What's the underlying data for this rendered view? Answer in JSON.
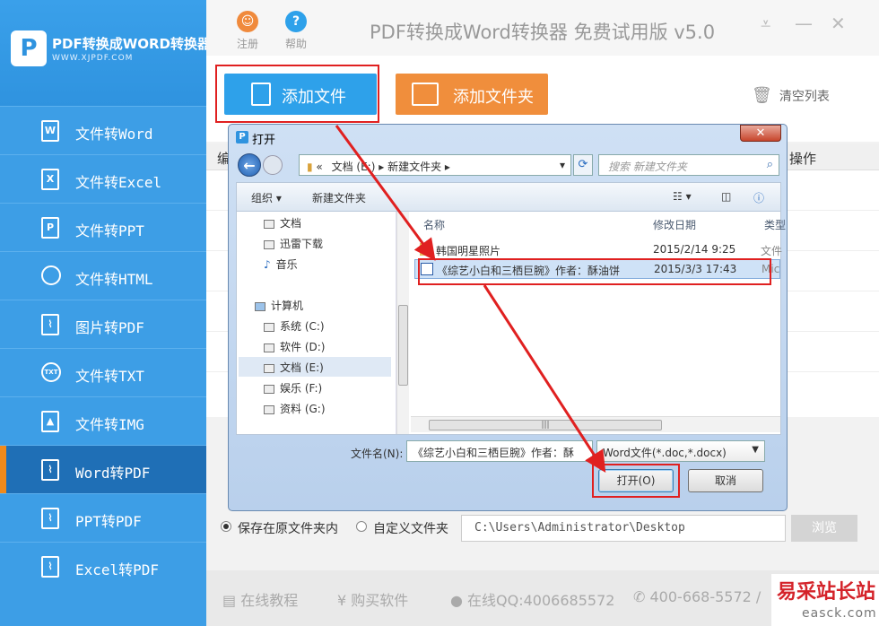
{
  "brand": {
    "title": "PDF转换成WORD转换器",
    "url": "WWW.XJPDF.COM",
    "logo_letter": "P"
  },
  "app_title": "PDF转换成Word转换器 免费试用版 v5.0",
  "top_buttons": [
    {
      "icon": "user-icon",
      "label": "注册"
    },
    {
      "icon": "help-icon",
      "label": "帮助"
    }
  ],
  "sidebar": {
    "items": [
      {
        "icon": "W",
        "label": "文件转Word"
      },
      {
        "icon": "X",
        "label": "文件转Excel"
      },
      {
        "icon": "P",
        "label": "文件转PPT"
      },
      {
        "icon": "globe-icon",
        "label": "文件转HTML"
      },
      {
        "icon": "pdf-icon",
        "label": "图片转PDF"
      },
      {
        "icon": "TXT",
        "label": "文件转TXT"
      },
      {
        "icon": "image-icon",
        "label": "文件转IMG"
      },
      {
        "icon": "pdf-icon",
        "label": "Word转PDF"
      },
      {
        "icon": "pdf-icon",
        "label": "PPT转PDF"
      },
      {
        "icon": "pdf-icon",
        "label": "Excel转PDF"
      }
    ],
    "active_index": 7
  },
  "toolbar": {
    "add_file": "添加文件",
    "add_folder": "添加文件夹",
    "clear_list": "清空列表"
  },
  "table": {
    "col_left": "编",
    "col_right": "操作"
  },
  "save": {
    "option_original": "保存在原文件夹内",
    "option_custom": "自定义文件夹",
    "path": "C:\\Users\\Administrator\\Desktop",
    "browse": "浏览"
  },
  "footer": {
    "tutorial": "在线教程",
    "buy": "购买软件",
    "qq": "在线QQ:4006685572",
    "phone": "400-668-5572 /"
  },
  "watermark": {
    "line1": "易采站长站",
    "line2": "easck.com"
  },
  "dialog": {
    "title": "打开",
    "close": "✕",
    "address": [
      "«",
      "文档 (E:)",
      "新建文件夹"
    ],
    "search_placeholder": "搜索 新建文件夹",
    "organize": "组织 ▾",
    "new_folder": "新建文件夹",
    "tree": [
      {
        "label": "文档"
      },
      {
        "label": "迅雷下载"
      },
      {
        "label": "音乐"
      },
      {
        "label": "计算机"
      },
      {
        "label": "系统 (C:)"
      },
      {
        "label": "软件 (D:)"
      },
      {
        "label": "文档 (E:)"
      },
      {
        "label": "娱乐 (F:)"
      },
      {
        "label": "资料 (G:)"
      }
    ],
    "columns": {
      "name": "名称",
      "date": "修改日期",
      "type": "类型"
    },
    "files": [
      {
        "name": "韩国明星照片",
        "date": "2015/2/14 9:25",
        "type": "文件"
      },
      {
        "name": "《综艺小白和三栖巨腕》作者：酥油饼",
        "date": "2015/3/3 17:43",
        "type": "Mic"
      }
    ],
    "filename_label": "文件名(N):",
    "filename_value": "《综艺小白和三栖巨腕》作者：酥",
    "filetype": "Word文件(*.doc,*.docx)",
    "open": "打开(O)",
    "cancel": "取消"
  }
}
